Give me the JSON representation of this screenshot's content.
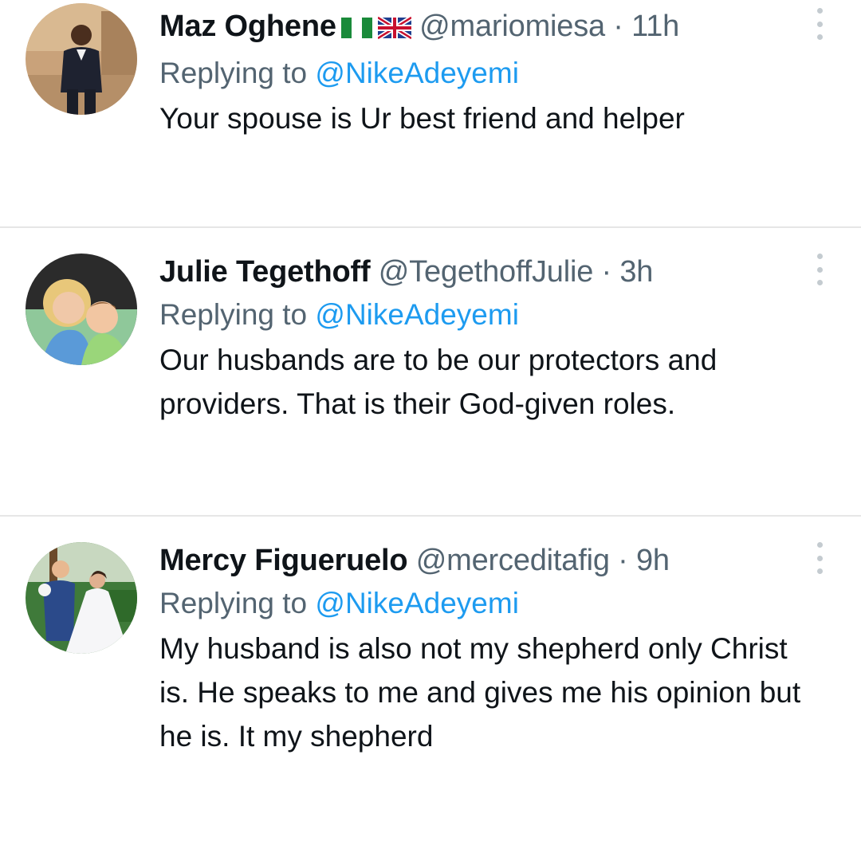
{
  "reply_prefix": "Replying to",
  "colors": {
    "mention": "#1d9bf0",
    "meta": "#536471",
    "divider": "#e6e6e6"
  },
  "tweets": [
    {
      "name": "Maz Oghene",
      "flags": [
        "nigeria-flag-icon",
        "uk-flag-icon"
      ],
      "handle": "@mariomiesa",
      "dot": "·",
      "time": "11h",
      "reply_to": "@NikeAdeyemi",
      "text": "Your spouse is Ur best friend and helper"
    },
    {
      "name": "Julie Tegethoff",
      "handle": "@TegethoffJulie",
      "dot": "·",
      "time": "3h",
      "reply_to": "@NikeAdeyemi",
      "text": "Our husbands are to be our protectors and providers. That is their God-given roles."
    },
    {
      "name": "Mercy Figueruelo",
      "handle": "@merceditafig",
      "dot": "·",
      "time": "9h",
      "reply_to": "@NikeAdeyemi",
      "text": "My husband is also not my shepherd only Christ is. He speaks to me and gives me his opinion but he is. It my shepherd"
    }
  ]
}
